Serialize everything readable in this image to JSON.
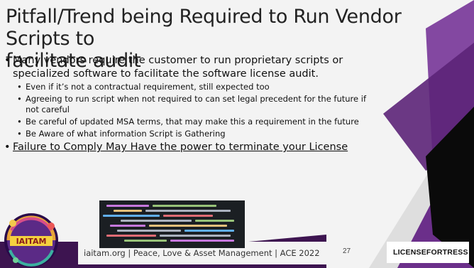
{
  "title": {
    "line1": "Pitfall/Trend being Required to Run Vendor Scripts to",
    "line2": "facilitate audit"
  },
  "bullets": {
    "main1": "Many vendors require the customer to run proprietary scripts or specialized software to facilitate the software license audit.",
    "sub": [
      "Even if it’s not a contractual requirement, still expected too",
      "Agreeing to run script when not required to can set legal precedent for the future if not careful",
      "Be careful of updated MSA terms, that may make this a requirement in the future",
      "Be Aware of what information Script is Gathering"
    ],
    "main2": "Failure to Comply May Have the power to terminate your License"
  },
  "footer": {
    "text": "iaitam.org | Peace, Love & Asset Management | ACE 2022",
    "page_number": "27"
  },
  "logos": {
    "left_logo_text": "IAITAM",
    "right_logo_text": "LICENSEFORTRESS"
  },
  "colors": {
    "accent_purple": "#6b2f8a",
    "dark_purple": "#3d1450",
    "background": "#f3f3f3"
  }
}
